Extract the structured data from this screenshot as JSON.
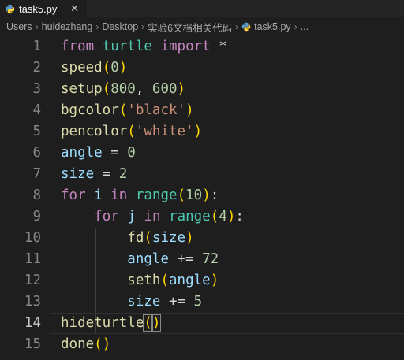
{
  "tab": {
    "label": "task5.py",
    "close": "✕"
  },
  "breadcrumb": {
    "items": [
      "Users",
      "huidezhang",
      "Desktop",
      "实验6文档相关代码",
      "task5.py",
      "..."
    ]
  },
  "editor": {
    "current_line": 14,
    "lines": [
      {
        "n": "1",
        "tokens": [
          [
            "kw",
            "from"
          ],
          [
            "op",
            " "
          ],
          [
            "mod",
            "turtle"
          ],
          [
            "op",
            " "
          ],
          [
            "kw",
            "import"
          ],
          [
            "op",
            " *"
          ]
        ]
      },
      {
        "n": "2",
        "tokens": [
          [
            "fn",
            "speed"
          ],
          [
            "p1",
            "("
          ],
          [
            "num",
            "0"
          ],
          [
            "p1",
            ")"
          ]
        ]
      },
      {
        "n": "3",
        "tokens": [
          [
            "fn",
            "setup"
          ],
          [
            "p1",
            "("
          ],
          [
            "num",
            "800"
          ],
          [
            "op",
            ", "
          ],
          [
            "num",
            "600"
          ],
          [
            "p1",
            ")"
          ]
        ]
      },
      {
        "n": "4",
        "tokens": [
          [
            "fn",
            "bgcolor"
          ],
          [
            "p1",
            "("
          ],
          [
            "str",
            "'black'"
          ],
          [
            "p1",
            ")"
          ]
        ]
      },
      {
        "n": "5",
        "tokens": [
          [
            "fn",
            "pencolor"
          ],
          [
            "p1",
            "("
          ],
          [
            "str",
            "'white'"
          ],
          [
            "p1",
            ")"
          ]
        ]
      },
      {
        "n": "6",
        "tokens": [
          [
            "var",
            "angle"
          ],
          [
            "op",
            " = "
          ],
          [
            "num",
            "0"
          ]
        ]
      },
      {
        "n": "7",
        "tokens": [
          [
            "var",
            "size"
          ],
          [
            "op",
            " = "
          ],
          [
            "num",
            "2"
          ]
        ]
      },
      {
        "n": "8",
        "tokens": [
          [
            "kw",
            "for"
          ],
          [
            "op",
            " "
          ],
          [
            "var",
            "i"
          ],
          [
            "op",
            " "
          ],
          [
            "kw",
            "in"
          ],
          [
            "op",
            " "
          ],
          [
            "mod",
            "range"
          ],
          [
            "p1",
            "("
          ],
          [
            "num",
            "10"
          ],
          [
            "p1",
            ")"
          ],
          [
            "op",
            ":"
          ]
        ]
      },
      {
        "n": "9",
        "tokens": [
          [
            "op",
            "    "
          ],
          [
            "kw",
            "for"
          ],
          [
            "op",
            " "
          ],
          [
            "var",
            "j"
          ],
          [
            "op",
            " "
          ],
          [
            "kw",
            "in"
          ],
          [
            "op",
            " "
          ],
          [
            "mod",
            "range"
          ],
          [
            "p1",
            "("
          ],
          [
            "num",
            "4"
          ],
          [
            "p1",
            ")"
          ],
          [
            "op",
            ":"
          ]
        ]
      },
      {
        "n": "10",
        "tokens": [
          [
            "op",
            "        "
          ],
          [
            "fn",
            "fd"
          ],
          [
            "p1",
            "("
          ],
          [
            "var",
            "size"
          ],
          [
            "p1",
            ")"
          ]
        ]
      },
      {
        "n": "11",
        "tokens": [
          [
            "op",
            "        "
          ],
          [
            "var",
            "angle"
          ],
          [
            "op",
            " += "
          ],
          [
            "num",
            "72"
          ]
        ]
      },
      {
        "n": "12",
        "tokens": [
          [
            "op",
            "        "
          ],
          [
            "fn",
            "seth"
          ],
          [
            "p1",
            "("
          ],
          [
            "var",
            "angle"
          ],
          [
            "p1",
            ")"
          ]
        ]
      },
      {
        "n": "13",
        "tokens": [
          [
            "op",
            "        "
          ],
          [
            "var",
            "size"
          ],
          [
            "op",
            " += "
          ],
          [
            "num",
            "5"
          ]
        ]
      },
      {
        "n": "14",
        "tokens": [
          [
            "fn",
            "hideturtle"
          ],
          [
            "p1",
            "("
          ],
          [
            "p1",
            ")"
          ]
        ]
      },
      {
        "n": "15",
        "tokens": [
          [
            "fn",
            "done"
          ],
          [
            "p1",
            "("
          ],
          [
            "p1",
            ")"
          ]
        ]
      }
    ]
  }
}
